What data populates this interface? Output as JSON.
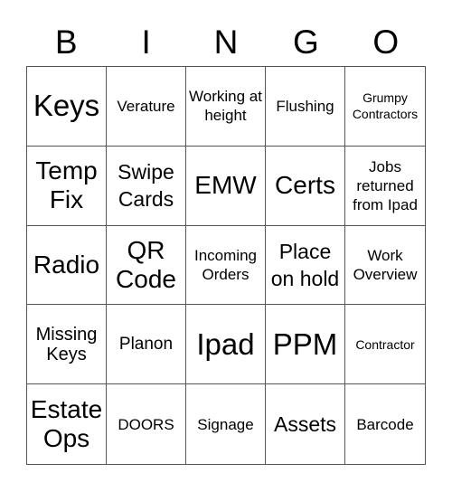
{
  "header": {
    "letters": [
      "B",
      "I",
      "N",
      "G",
      "O"
    ]
  },
  "board": {
    "cells": [
      {
        "text": "Keys",
        "size": "s-xl"
      },
      {
        "text": "Verature",
        "size": "s-s"
      },
      {
        "text": "Working at height",
        "size": "s-s"
      },
      {
        "text": "Flushing",
        "size": "s-s"
      },
      {
        "text": "Grumpy Contractors",
        "size": "s-xs"
      },
      {
        "text": "Temp Fix",
        "size": "s-l"
      },
      {
        "text": "Swipe Cards",
        "size": "s-m"
      },
      {
        "text": "EMW",
        "size": "s-l"
      },
      {
        "text": "Certs",
        "size": "s-l"
      },
      {
        "text": "Jobs returned from Ipad",
        "size": "s-s"
      },
      {
        "text": "Radio",
        "size": "s-l"
      },
      {
        "text": "QR Code",
        "size": "s-l"
      },
      {
        "text": "Incoming Orders",
        "size": "s-s"
      },
      {
        "text": "Place on hold",
        "size": "s-m"
      },
      {
        "text": "Work Overview",
        "size": "s-s"
      },
      {
        "text": "Missing Keys",
        "size": "s-ml"
      },
      {
        "text": "Planon",
        "size": "s-md"
      },
      {
        "text": "Ipad",
        "size": "s-xl"
      },
      {
        "text": "PPM",
        "size": "s-xl"
      },
      {
        "text": "Contractor",
        "size": "s-xs"
      },
      {
        "text": "Estate Ops",
        "size": "s-l"
      },
      {
        "text": "DOORS",
        "size": "s-s"
      },
      {
        "text": "Signage",
        "size": "s-s"
      },
      {
        "text": "Assets",
        "size": "s-m"
      },
      {
        "text": "Barcode",
        "size": "s-s"
      }
    ]
  }
}
